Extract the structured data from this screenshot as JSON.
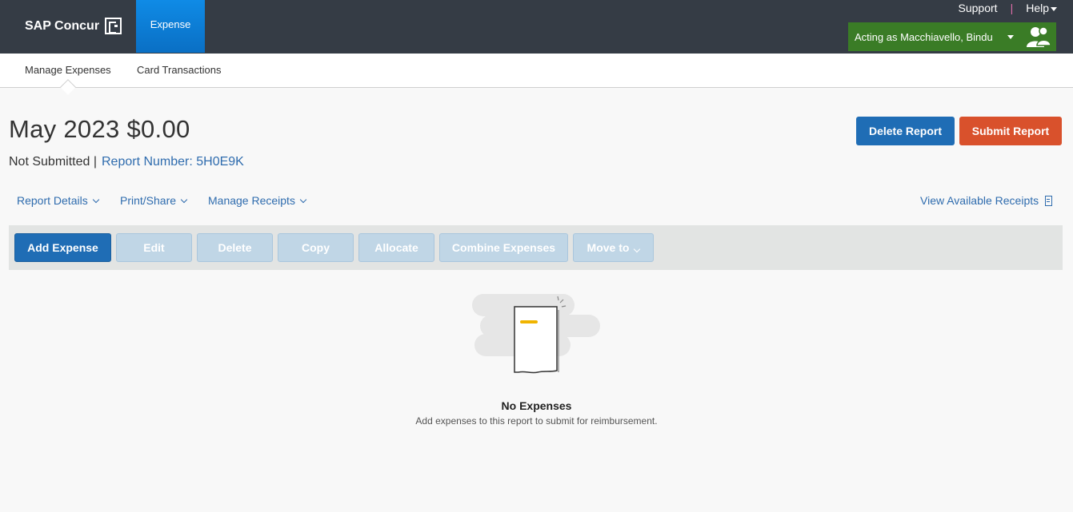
{
  "header": {
    "brand": "SAP Concur",
    "active_tab": "Expense",
    "support": "Support",
    "separator": "|",
    "help": "Help",
    "acting_as": "Acting as Macchiavello, Bindu"
  },
  "subnav": {
    "items": [
      "Manage Expenses",
      "Card Transactions"
    ],
    "active": "Manage Expenses"
  },
  "report": {
    "title": "May 2023 $0.00",
    "status": "Not Submitted |",
    "report_number": "Report Number: 5H0E9K",
    "delete_label": "Delete Report",
    "submit_label": "Submit Report"
  },
  "menus": {
    "report_details": "Report Details",
    "print_share": "Print/Share",
    "manage_receipts": "Manage Receipts",
    "view_receipts": "View Available Receipts"
  },
  "toolbar": {
    "add_expense": "Add Expense",
    "edit": "Edit",
    "delete": "Delete",
    "copy": "Copy",
    "allocate": "Allocate",
    "combine": "Combine Expenses",
    "move_to": "Move to"
  },
  "empty": {
    "title": "No Expenses",
    "subtitle": "Add expenses to this report to submit for reimbursement."
  },
  "colors": {
    "header_bg": "#353c45",
    "accent_blue": "#1f6db5",
    "submit_orange": "#d9512c",
    "acting_green": "#3a7c26",
    "link_blue": "#2f6cae"
  }
}
